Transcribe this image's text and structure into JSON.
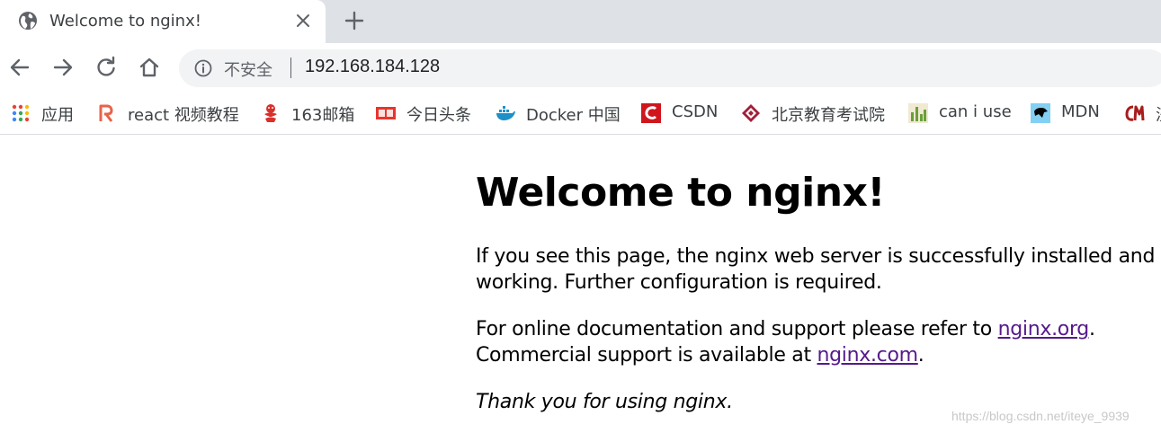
{
  "tab": {
    "title": "Welcome to nginx!"
  },
  "toolbar": {
    "security_label": "不安全",
    "url": "192.168.184.128"
  },
  "bookmarks": [
    {
      "label": "应用",
      "icon": "apps-grid-icon"
    },
    {
      "label": "react 视频教程",
      "icon": "react-r-icon"
    },
    {
      "label": "163邮箱",
      "icon": "163-mail-icon"
    },
    {
      "label": "今日头条",
      "icon": "toutiao-icon"
    },
    {
      "label": "Docker 中国",
      "icon": "docker-whale-icon"
    },
    {
      "label": "CSDN",
      "icon": "csdn-icon"
    },
    {
      "label": "北京教育考试院",
      "icon": "bjeea-icon"
    },
    {
      "label": "can i use",
      "icon": "caniuse-icon"
    },
    {
      "label": "MDN",
      "icon": "mdn-icon"
    },
    {
      "label": "济",
      "icon": "cm-icon"
    }
  ],
  "page": {
    "heading": "Welcome to nginx!",
    "p1": "If you see this page, the nginx web server is successfully installed and working. Further configuration is required.",
    "p2_before": "For online documentation and support please refer to ",
    "p2_link1": "nginx.org",
    "p2_middle": ".",
    "p2_line2": "Commercial support is available at ",
    "p2_link2": "nginx.com",
    "p2_end": ".",
    "p3": "Thank you for using nginx."
  },
  "watermark": "https://blog.csdn.net/iteye_9939",
  "colors": {
    "tabstrip_bg": "#dee1e6",
    "omnibox_bg": "#f1f3f4",
    "visited_link": "#551a8b"
  }
}
